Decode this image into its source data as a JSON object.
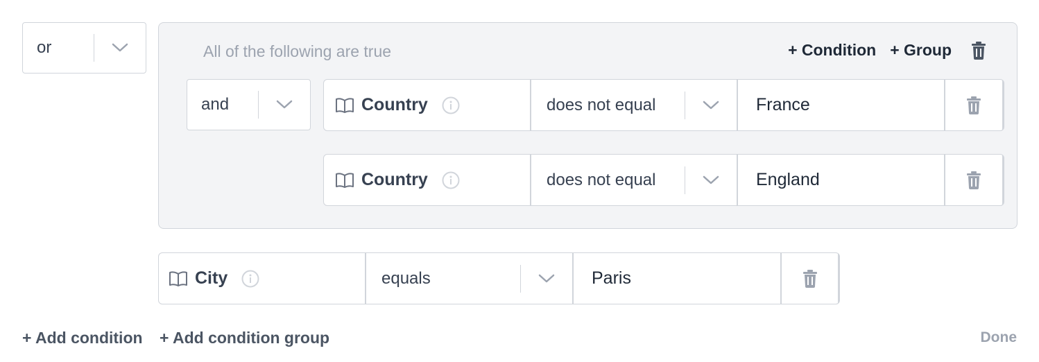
{
  "root": {
    "combinator": "or"
  },
  "group": {
    "title": "All of the following are true",
    "add_condition_label": "+ Condition",
    "add_group_label": "+ Group",
    "combinator": "and",
    "conditions": [
      {
        "field": "Country",
        "operator": "does not equal",
        "value": "France"
      },
      {
        "field": "Country",
        "operator": "does not equal",
        "value": "England"
      }
    ]
  },
  "condition": {
    "field": "City",
    "operator": "equals",
    "value": "Paris"
  },
  "footer": {
    "add_condition_label": "+ Add condition",
    "add_condition_group_label": "+ Add condition group",
    "done_label": "Done"
  },
  "icons": {
    "chevron": "chevron-down-icon",
    "book": "book-icon",
    "info": "info-icon",
    "trash": "trash-icon"
  },
  "colors": {
    "border": "#d1d5db",
    "group_bg": "#f3f4f6",
    "muted_text": "#9ca3af",
    "icon_gray": "#9ca3af",
    "icon_dark": "#4b5563"
  }
}
